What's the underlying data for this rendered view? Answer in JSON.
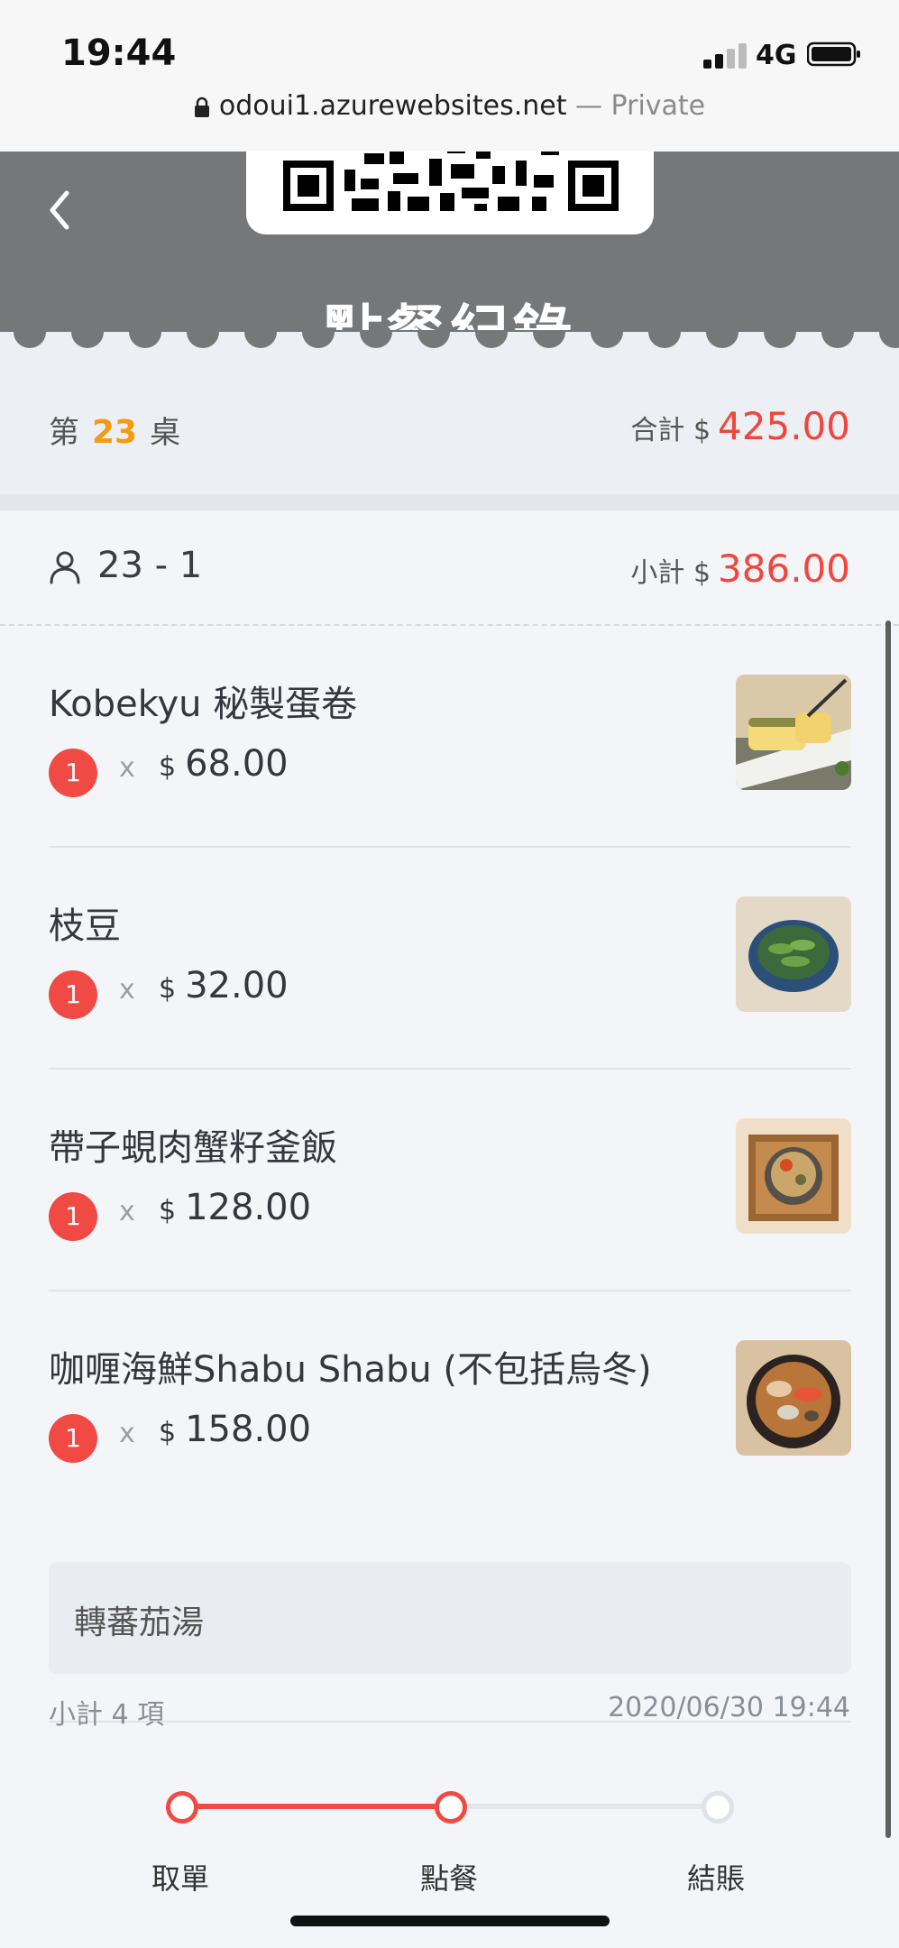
{
  "status_bar": {
    "time": "19:44",
    "network": "4G"
  },
  "browser": {
    "domain": "odoui1.azurewebsites.net",
    "mode": " — Private"
  },
  "header": {
    "title": "點餐紀錄"
  },
  "summary": {
    "table_prefix": "第",
    "table_number": "23",
    "table_suffix": "桌",
    "total_label": "合計 $",
    "total_value": "425.00"
  },
  "guest": {
    "label": "23 - 1",
    "subtotal_label": "小計 $",
    "subtotal_value": "386.00"
  },
  "items": [
    {
      "name": "Kobekyu 秘製蛋卷",
      "qty": "1",
      "x": "x",
      "currency": "$",
      "price": "68.00",
      "thumb": "egg-roll"
    },
    {
      "name": "枝豆",
      "qty": "1",
      "x": "x",
      "currency": "$",
      "price": "32.00",
      "thumb": "edamame"
    },
    {
      "name": "帶子蜆肉蟹籽釜飯",
      "qty": "1",
      "x": "x",
      "currency": "$",
      "price": "128.00",
      "thumb": "kamameshi"
    },
    {
      "name": "咖喱海鮮Shabu Shabu (不包括烏冬)",
      "qty": "1",
      "x": "x",
      "currency": "$",
      "price": "158.00",
      "thumb": "shabu",
      "note": "轉蕃茄湯"
    }
  ],
  "footer": {
    "item_count": "小計 4 項",
    "datetime": "2020/06/30 19:44"
  },
  "steps": [
    {
      "label": "取單",
      "active": true
    },
    {
      "label": "點餐",
      "active": true
    },
    {
      "label": "結賬",
      "active": false
    }
  ],
  "colors": {
    "accent": "#f14a44",
    "table_number": "#f39c12",
    "header_bg": "#767779"
  }
}
